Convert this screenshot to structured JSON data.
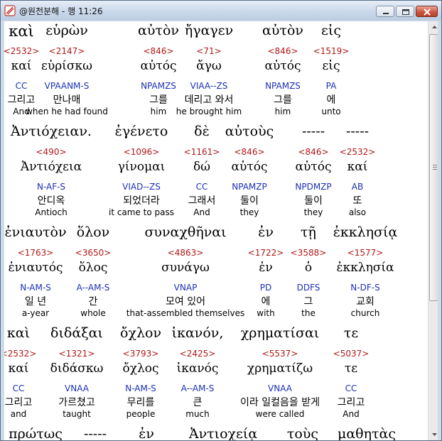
{
  "window": {
    "title": "@원전분해 - 행 11:26"
  },
  "rows": [
    {
      "words": [
        {
          "greek": "καὶ",
          "strong": "<2532>",
          "lemma": "καί",
          "parse": "CC",
          "korean": "그리고",
          "english": "And"
        },
        {
          "greek": "εὑρὼν",
          "strong": "<2147>",
          "lemma": "εὑρίσκω",
          "parse": "VPAANM-S",
          "korean": "만나매",
          "english": "when he had found"
        },
        {
          "greek": "αὐτὸν",
          "strong": "<846>",
          "lemma": "αὐτός",
          "parse": "NPAMZS",
          "korean": "그를",
          "english": "him"
        },
        {
          "greek": "ἤγαγεν",
          "strong": "<71>",
          "lemma": "ἄγω",
          "parse": "VIAA--ZS",
          "korean": "데리고 와서",
          "english": "he brought him"
        },
        {
          "greek": "αὐτὸν",
          "strong": "<846>",
          "lemma": "αὐτός",
          "parse": "NPAMZS",
          "korean": "그를",
          "english": "him"
        },
        {
          "greek": "εἰς",
          "strong": "<1519>",
          "lemma": "εἰς",
          "parse": "PA",
          "korean": "에",
          "english": "unto"
        }
      ]
    },
    {
      "words": [
        {
          "greek": "Ἀντιόχειαν.",
          "strong": "<490>",
          "lemma": "Ἀντιόχεια",
          "parse": "N-AF-S",
          "korean": "안디옥",
          "english": "Antioch"
        },
        {
          "greek": "ἐγένετο",
          "strong": "<1096>",
          "lemma": "γίνομαι",
          "parse": "VIAD--ZS",
          "korean": "되었더라",
          "english": "it came to pass"
        },
        {
          "greek": "δὲ",
          "strong": "<1161>",
          "lemma": "δώ",
          "parse": "CC",
          "korean": "그래서",
          "english": "And"
        },
        {
          "greek": "αὐτοὺς",
          "strong": "<846>",
          "lemma": "αὐτός",
          "parse": "NPAMZP",
          "korean": "둘이",
          "english": "they"
        },
        {
          "greek": "-----",
          "strong": "<846>",
          "lemma": "αὐτός",
          "parse": "NPDMZP",
          "korean": "둘이",
          "english": "they"
        },
        {
          "greek": "-----",
          "strong": "<2532>",
          "lemma": "καί",
          "parse": "AB",
          "korean": "또",
          "english": "also"
        }
      ]
    },
    {
      "words": [
        {
          "greek": "ἐνιαυτὸν",
          "strong": "<1763>",
          "lemma": "ἐνιαυτός",
          "parse": "N-AM-S",
          "korean": "일 년",
          "english": "a-year"
        },
        {
          "greek": "ὅλον",
          "strong": "<3650>",
          "lemma": "ὅλος",
          "parse": "A--AM-S",
          "korean": "간",
          "english": "whole"
        },
        {
          "greek": "συναχθῆναι",
          "strong": "<4863>",
          "lemma": "συνάγω",
          "parse": "VNAP",
          "korean": "모여 있어",
          "english": "that-assembled themselves"
        },
        {
          "greek": "ἐν",
          "strong": "<1722>",
          "lemma": "ἐν",
          "parse": "PD",
          "korean": "에",
          "english": "with"
        },
        {
          "greek": "τῇ",
          "strong": "<3588>",
          "lemma": "ὁ",
          "parse": "DDFS",
          "korean": "그",
          "english": "the"
        },
        {
          "greek": "ἐκκλησίᾳ",
          "strong": "<1577>",
          "lemma": "ἐκκλησία",
          "parse": "N-DF-S",
          "korean": "교회",
          "english": "church"
        }
      ]
    },
    {
      "words": [
        {
          "greek": "καὶ",
          "strong": "<2532>",
          "lemma": "καί",
          "parse": "CC",
          "korean": "그리고",
          "english": "and"
        },
        {
          "greek": "διδάξαι",
          "strong": "<1321>",
          "lemma": "διδάσκω",
          "parse": "VNAA",
          "korean": "가르쳤고",
          "english": "taught"
        },
        {
          "greek": "ὄχλον",
          "strong": "<3793>",
          "lemma": "ὄχλος",
          "parse": "N-AM-S",
          "korean": "무리를",
          "english": "people"
        },
        {
          "greek": "ἱκανόν,",
          "strong": "<2425>",
          "lemma": "ἱκανός",
          "parse": "A--AM-S",
          "korean": "큰",
          "english": "much"
        },
        {
          "greek": "χρηματίσαι",
          "strong": "<5537>",
          "lemma": "χρηματίζω",
          "parse": "VNAA",
          "korean": "이라 일컬음을 받게",
          "english": "were called"
        },
        {
          "greek": "τε",
          "strong": "<5037>",
          "lemma": "τε",
          "parse": "CC",
          "korean": "그리고",
          "english": "And"
        }
      ]
    },
    {
      "words": [
        {
          "greek": "πρώτως",
          "strong": "",
          "lemma": "",
          "parse": "",
          "korean": "",
          "english": ""
        },
        {
          "greek": "-----",
          "strong": "",
          "lemma": "",
          "parse": "",
          "korean": "",
          "english": ""
        },
        {
          "greek": "ἐν",
          "strong": "",
          "lemma": "",
          "parse": "",
          "korean": "",
          "english": ""
        },
        {
          "greek": "Ἀντιοχείᾳ",
          "strong": "",
          "lemma": "",
          "parse": "",
          "korean": "",
          "english": ""
        },
        {
          "greek": "τοὺς",
          "strong": "",
          "lemma": "",
          "parse": "",
          "korean": "",
          "english": ""
        },
        {
          "greek": "μαθητὰς",
          "strong": "",
          "lemma": "",
          "parse": "",
          "korean": "",
          "english": ""
        }
      ]
    }
  ]
}
